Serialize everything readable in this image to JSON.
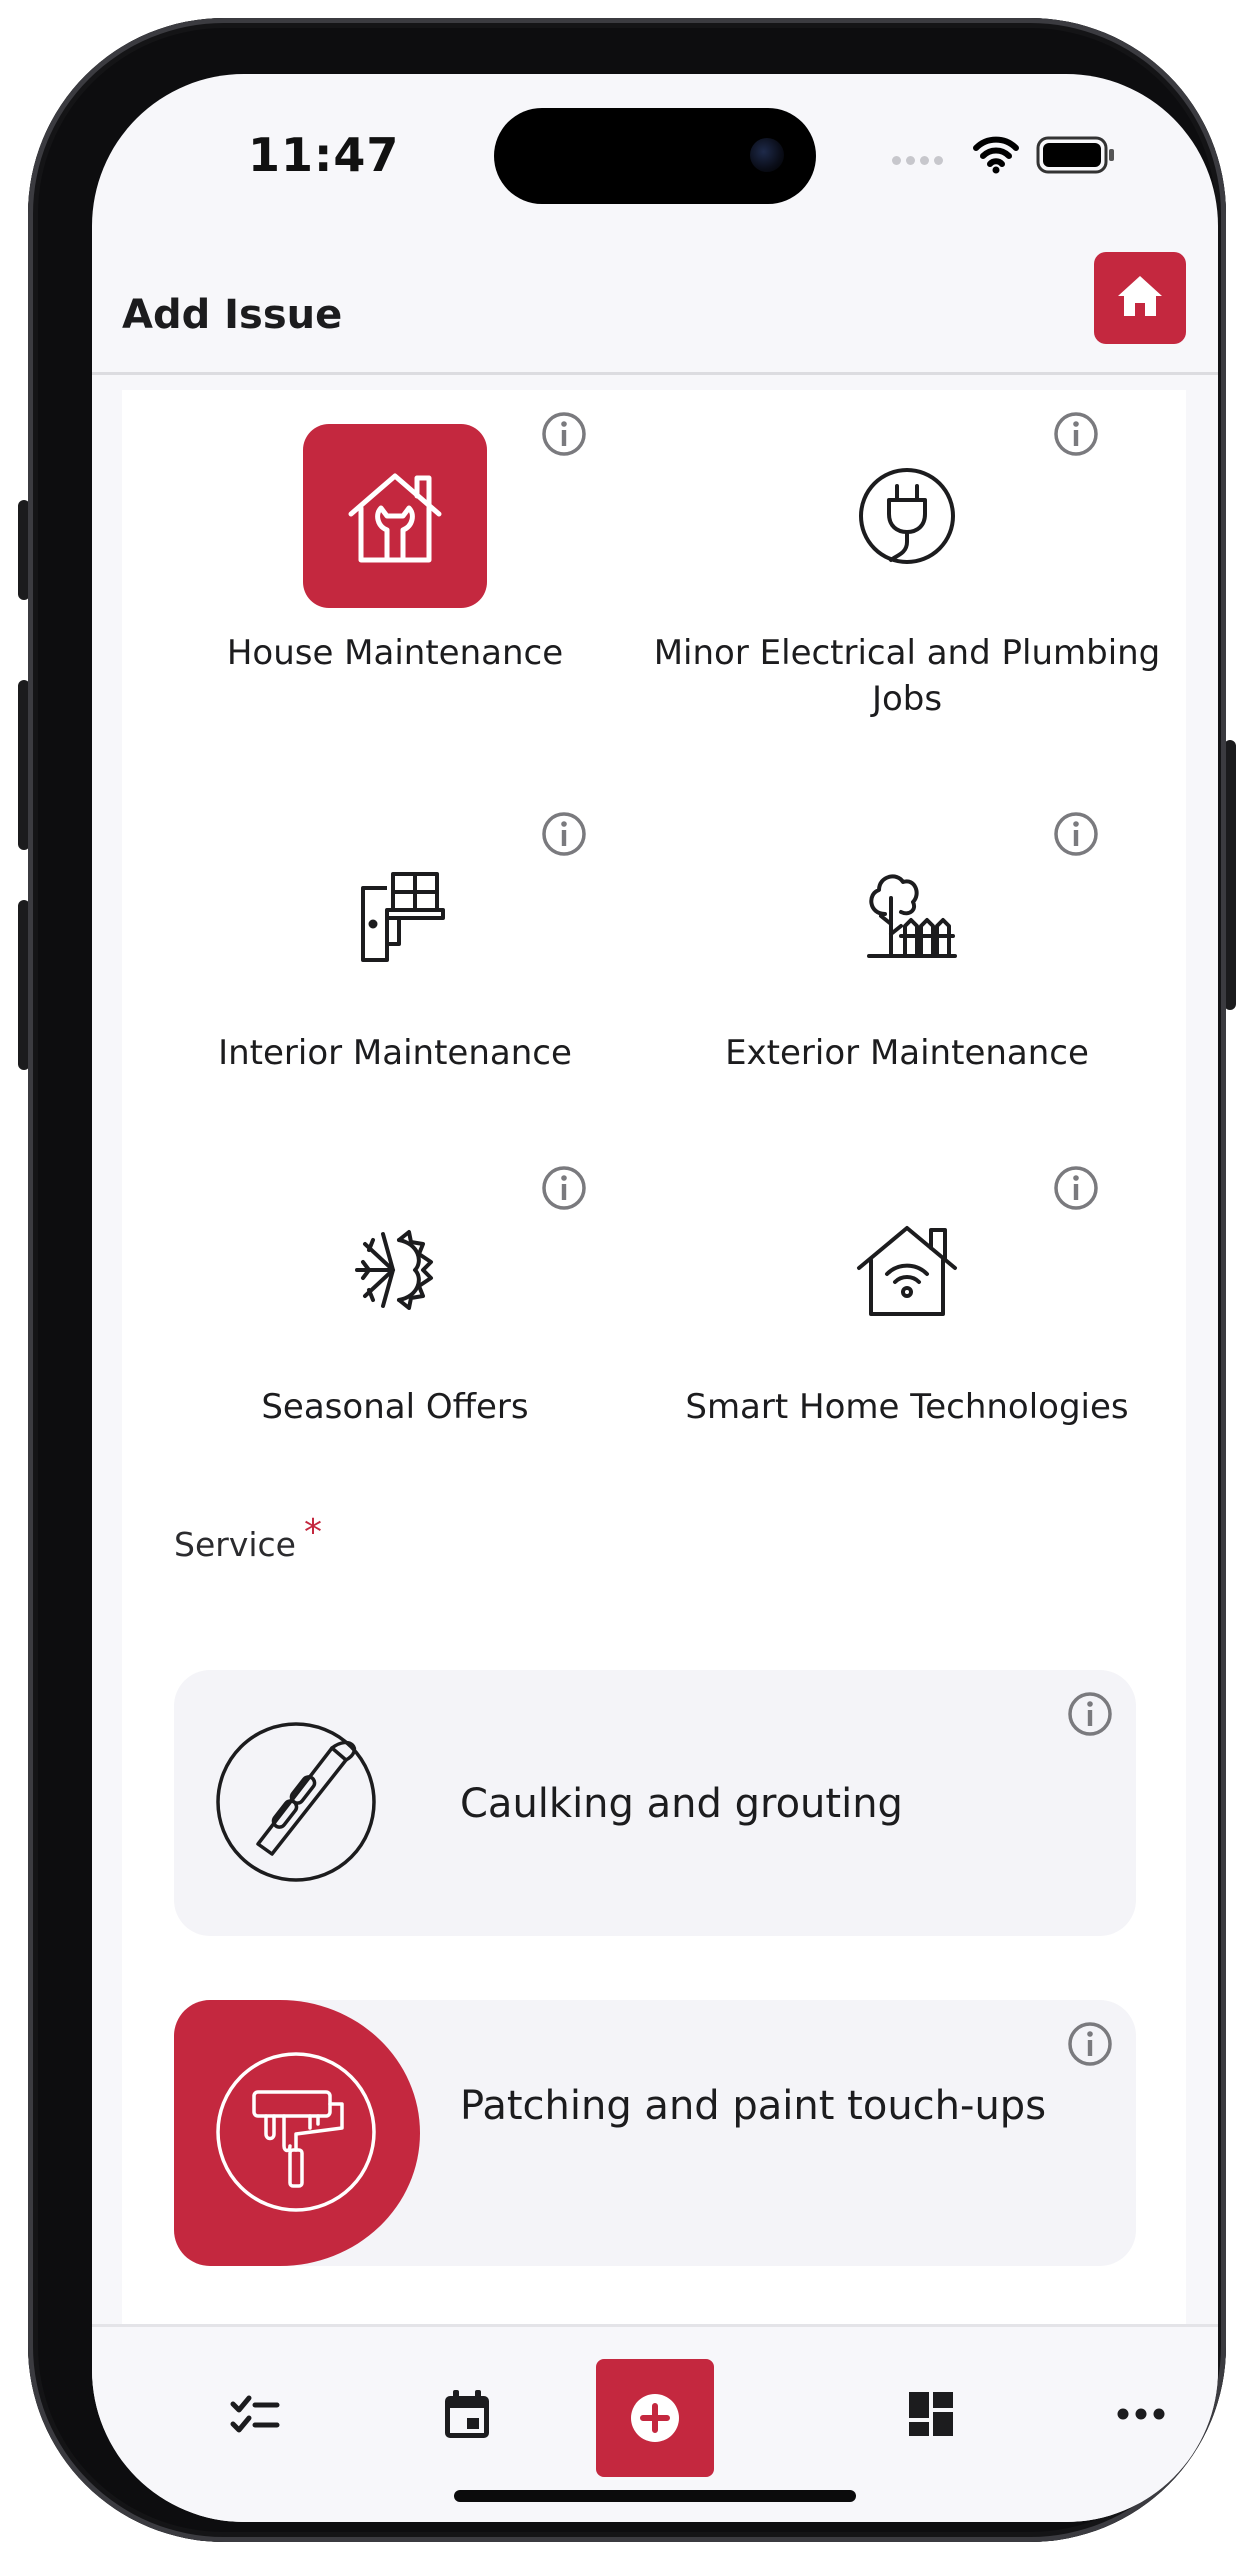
{
  "status_bar": {
    "time": "11:47"
  },
  "header": {
    "title": "Add Issue"
  },
  "categories": [
    {
      "label": "House Maintenance",
      "icon": "house-wrench-icon",
      "selected": true
    },
    {
      "label": "Minor Electrical and Plumbing Jobs",
      "icon": "plug-icon",
      "selected": false
    },
    {
      "label": "Interior Maintenance",
      "icon": "door-window-icon",
      "selected": false
    },
    {
      "label": "Exterior Maintenance",
      "icon": "tree-fence-icon",
      "selected": false
    },
    {
      "label": "Seasonal Offers",
      "icon": "snow-sun-icon",
      "selected": false
    },
    {
      "label": "Smart Home Technologies",
      "icon": "smart-home-wifi-icon",
      "selected": false
    }
  ],
  "service": {
    "label": "Service",
    "required_mark": "*",
    "items": [
      {
        "name": "Caulking and grouting",
        "icon": "caulking-trowel-icon",
        "selected": false
      },
      {
        "name": "Patching and paint touch-ups",
        "icon": "paint-roller-icon",
        "selected": true
      }
    ]
  },
  "tab_bar": {
    "items": [
      "checklist-icon",
      "calendar-icon",
      "add-icon",
      "dashboard-icon",
      "more-icon"
    ]
  },
  "colors": {
    "accent": "#c4283f",
    "background": "#f7f7fa",
    "card": "#f4f4f8"
  }
}
